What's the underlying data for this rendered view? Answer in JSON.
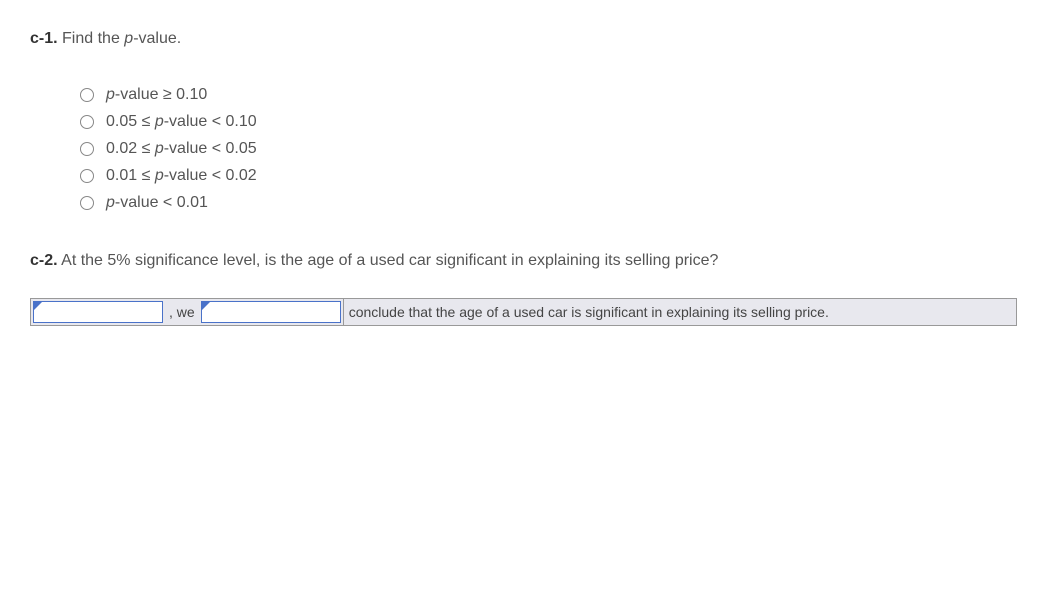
{
  "c1": {
    "label": "c-1.",
    "prompt_before": " Find the ",
    "prompt_italic": "p",
    "prompt_after": "-value.",
    "options": [
      {
        "italic": "p",
        "rest": "-value ≥ 0.10"
      },
      {
        "pre": "0.05 ≤ ",
        "italic": "p",
        "rest": "-value < 0.10"
      },
      {
        "pre": "0.02 ≤ ",
        "italic": "p",
        "rest": "-value < 0.05"
      },
      {
        "pre": "0.01 ≤ ",
        "italic": "p",
        "rest": "-value < 0.02"
      },
      {
        "italic": "p",
        "rest": "-value < 0.01"
      }
    ]
  },
  "c2": {
    "label": "c-2.",
    "prompt": " At the 5% significance level, is the age of a used car significant in explaining its selling price?",
    "connector": ", we",
    "conclusion": "conclude that the age of a used car is significant in explaining its selling price."
  }
}
